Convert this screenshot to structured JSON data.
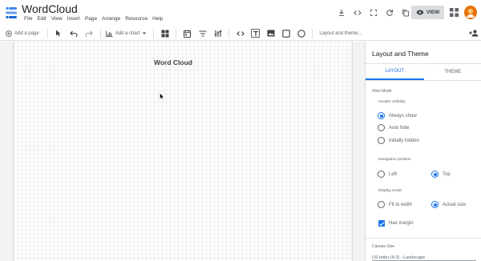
{
  "app": {
    "title": "WordCloud",
    "menu": [
      "File",
      "Edit",
      "View",
      "Insert",
      "Page",
      "Arrange",
      "Resource",
      "Help"
    ],
    "view_label": "VIEW"
  },
  "toolbar": {
    "add_page": "Add a page",
    "add_chart": "Add a chart",
    "layout_theme": "Layout and theme..."
  },
  "canvas": {
    "title": "Word Cloud"
  },
  "panel": {
    "title": "Layout and Theme",
    "tabs": [
      "LAYOUT",
      "THEME"
    ],
    "view_mode": "View Mode",
    "header_visibility": {
      "label": "Header visibility",
      "options": [
        "Always show",
        "Auto hide",
        "Initially hidden"
      ],
      "selected": "Always show"
    },
    "navigation_position": {
      "label": "Navigation position",
      "options": [
        "Left",
        "Top"
      ],
      "selected": "Top"
    },
    "display_mode": {
      "label": "Display mode",
      "options": [
        "Fit to width",
        "Actual size"
      ],
      "selected": "Actual size"
    },
    "has_margin": "Has margin",
    "canvas_size": {
      "label": "Canvas Size",
      "value": "US letter (4:3) - Landscape"
    }
  },
  "colors": {
    "accent": "#1a73e8",
    "logo_blue": "#4285f4",
    "avatar": "#e8710a"
  }
}
